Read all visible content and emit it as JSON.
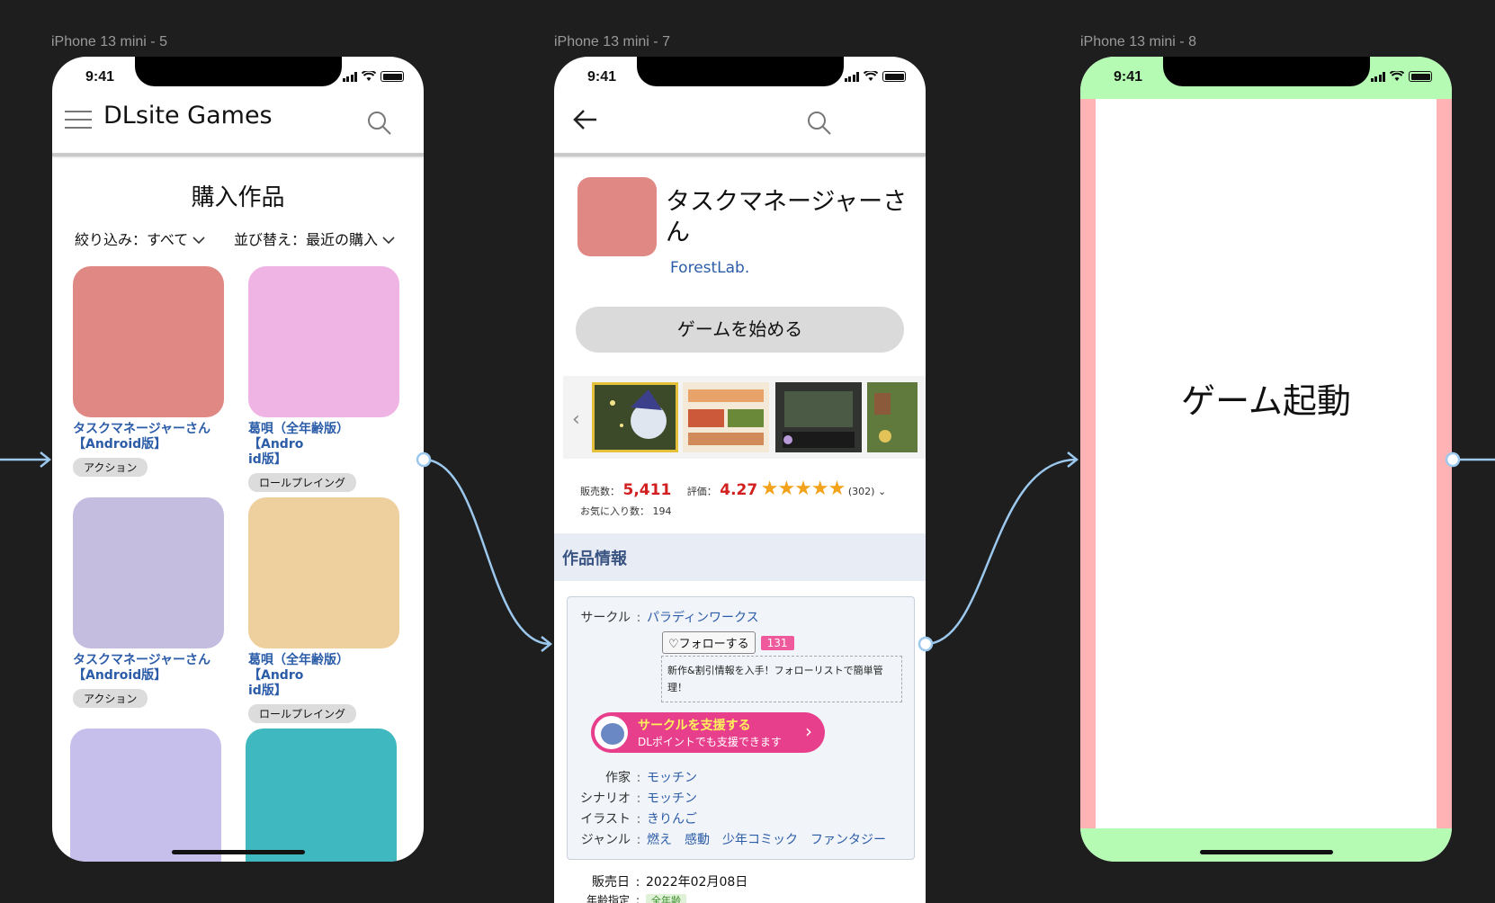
{
  "frames": [
    {
      "label": "iPhone 13 mini - 5"
    },
    {
      "label": "iPhone 13 mini - 7"
    },
    {
      "label": "iPhone 13 mini - 8"
    }
  ],
  "status": {
    "time": "9:41"
  },
  "screen1": {
    "app_title": "DLsite Games",
    "page_title": "購入作品",
    "filter_label": "絞り込み：すべて",
    "sort_label": "並び替え：最近の購入",
    "items": [
      {
        "name": "タスクマネージャーさん\n【Android版】",
        "tag": "アクション",
        "color": "#e08884"
      },
      {
        "name": "葛唄（全年齢版）　【Andro\nid版】",
        "tag": "ロールプレイング",
        "color": "#efb4e4"
      },
      {
        "name": "タスクマネージャーさん\n【Android版】",
        "tag": "アクション",
        "color": "#c4bde0"
      },
      {
        "name": "葛唄（全年齢版）　【Andro\nid版】",
        "tag": "ロールプレイング",
        "color": "#eecf9e"
      },
      {
        "name": "",
        "tag": "",
        "color": "#c6bfeb"
      },
      {
        "name": "",
        "tag": "",
        "color": "#40b8c0"
      }
    ]
  },
  "screen2": {
    "app_title": "タスクマネージャーさん",
    "developer": "ForestLab.",
    "play_button": "ゲームを始める",
    "sales_label": "販売数：",
    "sales_value": "5,411",
    "rating_label": "評価：",
    "rating_value": "4.27",
    "rating_stars": 4.27,
    "rating_count": "(302)",
    "favorites": "お気に入り数： 194",
    "section_title": "作品情報",
    "circle_label": "サークル",
    "circle_value": "パラディンワークス",
    "follow_button": "♡フォローする",
    "follow_count": "131",
    "follow_note": "新作&割引情報を入手！フォローリストで簡単管理！",
    "support_title": "サークルを支援する",
    "support_sub": "DLポイントでも支援できます",
    "credits": [
      {
        "k": "作家",
        "v": "モッチン"
      },
      {
        "k": "シナリオ",
        "v": "モッチン"
      },
      {
        "k": "イラスト",
        "v": "きりんご"
      },
      {
        "k": "ジャンル",
        "v": "燃え　感動　少年コミック　ファンタジー"
      }
    ],
    "release_label": "販売日",
    "release_value": "2022年02月08日",
    "age_label": "年齢指定",
    "age_value": "全年齢",
    "colors": {
      "accent": "#2b5ca8",
      "price": "#d21f1f",
      "support": "#e83f8c"
    }
  },
  "screen3": {
    "center_text": "ゲーム起動",
    "colors": {
      "bars": "#b6fbb4",
      "sides": "#ffb3b4"
    }
  },
  "connector_color": "#9cc8ee"
}
